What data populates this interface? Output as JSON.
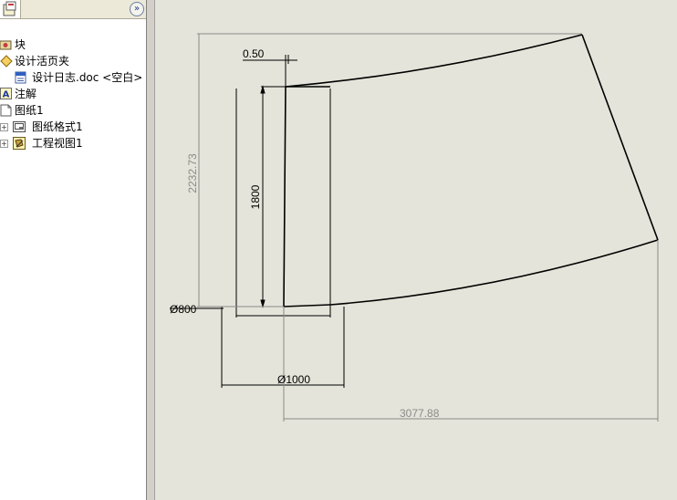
{
  "feature_tree": {
    "items": [
      {
        "label": "块",
        "icon": "block-icon"
      },
      {
        "label": "设计活页夹",
        "icon": "design-binder-icon"
      },
      {
        "label": "设计日志.doc  <空白>",
        "icon": "word-doc-icon"
      },
      {
        "label": "注解",
        "icon": "annotation-icon"
      },
      {
        "label": "图纸1",
        "icon": "sheet-icon"
      },
      {
        "label": "图纸格式1",
        "icon": "sheet-format-icon"
      },
      {
        "label": "工程视图1",
        "icon": "drawing-view-icon"
      }
    ],
    "expand_glyph": "»"
  },
  "drawing": {
    "dimensions": {
      "height_total": "2232.73",
      "top_offset": "0.50",
      "inner_height": "1800",
      "small_diameter": "Ø800",
      "large_diameter": "Ø1000",
      "total_width": "3077.88"
    },
    "colors": {
      "background": "#e4e4da",
      "geometry": "#000000",
      "dimension_gray": "#8a8a8a"
    }
  }
}
